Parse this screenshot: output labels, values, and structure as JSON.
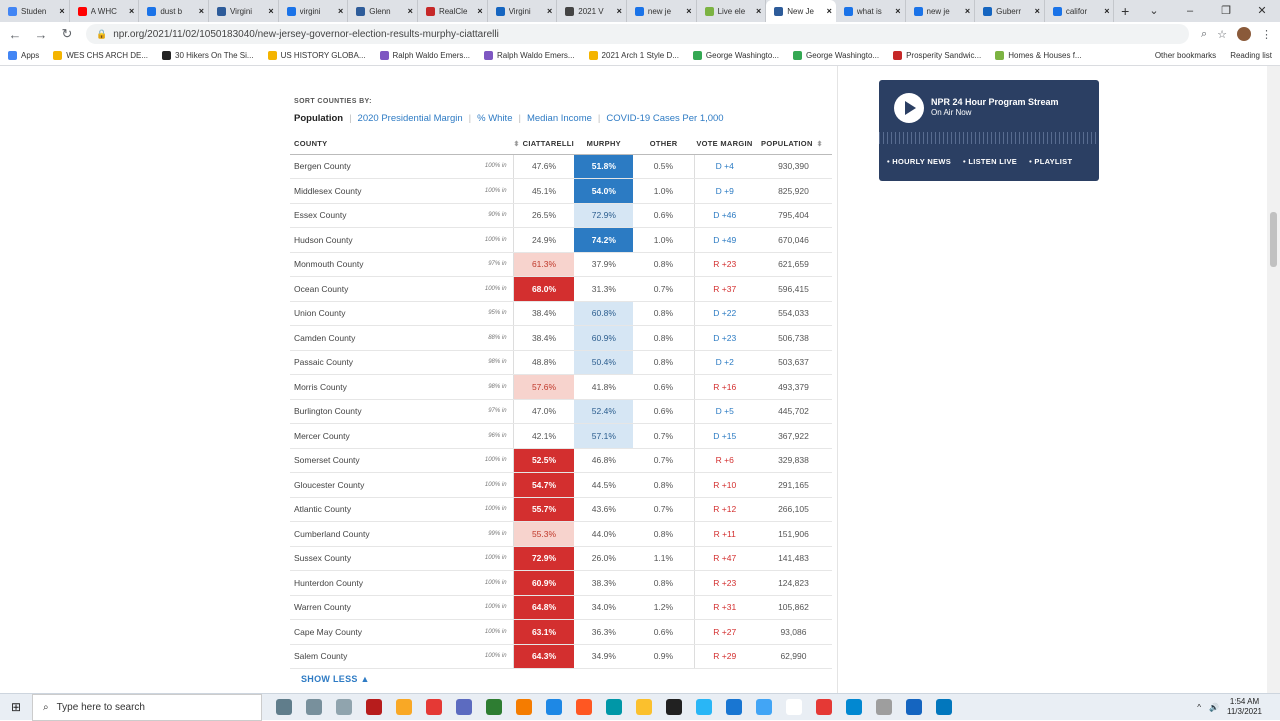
{
  "browser": {
    "tabs": [
      {
        "label": "Studen",
        "color": "#4285f4"
      },
      {
        "label": "A WHC",
        "color": "#ff0000"
      },
      {
        "label": "dust b",
        "color": "#1a73e8"
      },
      {
        "label": "Virgini",
        "color": "#2e5c9a"
      },
      {
        "label": "virgini",
        "color": "#1a73e8"
      },
      {
        "label": "Glenn",
        "color": "#2e5c9a"
      },
      {
        "label": "RealCle",
        "color": "#c62828"
      },
      {
        "label": "Virgini",
        "color": "#1565c0"
      },
      {
        "label": "2021 V",
        "color": "#444444"
      },
      {
        "label": "new je",
        "color": "#1a73e8"
      },
      {
        "label": "Live ele",
        "color": "#7cb342"
      },
      {
        "label": "New Je",
        "color": "#2e5c9a",
        "active": true
      },
      {
        "label": "what is",
        "color": "#1a73e8"
      },
      {
        "label": "new je",
        "color": "#1a73e8"
      },
      {
        "label": "Guberr",
        "color": "#1565c0"
      },
      {
        "label": "califor",
        "color": "#1a73e8"
      }
    ],
    "url": "npr.org/2021/11/02/1050183040/new-jersey-governor-election-results-murphy-ciattarelli",
    "bookmarks": [
      {
        "label": "Apps",
        "color": "#4285f4"
      },
      {
        "label": "WES CHS ARCH DE...",
        "color": "#f4b400"
      },
      {
        "label": "30 Hikers On The Si...",
        "color": "#222222"
      },
      {
        "label": "US HISTORY GLOBA...",
        "color": "#f4b400"
      },
      {
        "label": "Ralph Waldo Emers...",
        "color": "#7e57c2"
      },
      {
        "label": "Ralph Waldo Emers...",
        "color": "#7e57c2"
      },
      {
        "label": "2021 Arch 1 Style D...",
        "color": "#f4b400"
      },
      {
        "label": "George Washingto...",
        "color": "#34a853"
      },
      {
        "label": "George Washingto...",
        "color": "#34a853"
      },
      {
        "label": "Prosperity Sandwic...",
        "color": "#c62828"
      },
      {
        "label": "Homes & Houses f...",
        "color": "#7cb342"
      }
    ],
    "bookmarks_right": [
      "Other bookmarks",
      "Reading list"
    ]
  },
  "sort": {
    "label": "SORT COUNTIES BY:",
    "options": [
      "Population",
      "2020 Presidential Margin",
      "% White",
      "Median Income",
      "COVID-19 Cases Per 1,000"
    ]
  },
  "table": {
    "headers": [
      "COUNTY",
      "CIATTARELLI",
      "MURPHY",
      "OTHER",
      "VOTE MARGIN",
      "POPULATION"
    ],
    "rows": [
      {
        "county": "Bergen County",
        "pct_in": "100% in",
        "ciattarelli": "47.6%",
        "murphy": "51.8%",
        "other": "0.5%",
        "margin": "D +4",
        "population": "930,390",
        "shade": "d2"
      },
      {
        "county": "Middlesex County",
        "pct_in": "100% in",
        "ciattarelli": "45.1%",
        "murphy": "54.0%",
        "other": "1.0%",
        "margin": "D +9",
        "population": "825,920",
        "shade": "d2"
      },
      {
        "county": "Essex County",
        "pct_in": "90% in",
        "ciattarelli": "26.5%",
        "murphy": "72.9%",
        "other": "0.6%",
        "margin": "D +46",
        "population": "795,404",
        "shade": "d1"
      },
      {
        "county": "Hudson County",
        "pct_in": "100% in",
        "ciattarelli": "24.9%",
        "murphy": "74.2%",
        "other": "1.0%",
        "margin": "D +49",
        "population": "670,046",
        "shade": "d2"
      },
      {
        "county": "Monmouth County",
        "pct_in": "97% in",
        "ciattarelli": "61.3%",
        "murphy": "37.9%",
        "other": "0.8%",
        "margin": "R +23",
        "population": "621,659",
        "shade": "r1"
      },
      {
        "county": "Ocean County",
        "pct_in": "100% in",
        "ciattarelli": "68.0%",
        "murphy": "31.3%",
        "other": "0.7%",
        "margin": "R +37",
        "population": "596,415",
        "shade": "r2"
      },
      {
        "county": "Union County",
        "pct_in": "95% in",
        "ciattarelli": "38.4%",
        "murphy": "60.8%",
        "other": "0.8%",
        "margin": "D +22",
        "population": "554,033",
        "shade": "d1"
      },
      {
        "county": "Camden County",
        "pct_in": "88% in",
        "ciattarelli": "38.4%",
        "murphy": "60.9%",
        "other": "0.8%",
        "margin": "D +23",
        "population": "506,738",
        "shade": "d1"
      },
      {
        "county": "Passaic County",
        "pct_in": "98% in",
        "ciattarelli": "48.8%",
        "murphy": "50.4%",
        "other": "0.8%",
        "margin": "D +2",
        "population": "503,637",
        "shade": "d1"
      },
      {
        "county": "Morris County",
        "pct_in": "98% in",
        "ciattarelli": "57.6%",
        "murphy": "41.8%",
        "other": "0.6%",
        "margin": "R +16",
        "population": "493,379",
        "shade": "r1"
      },
      {
        "county": "Burlington County",
        "pct_in": "97% in",
        "ciattarelli": "47.0%",
        "murphy": "52.4%",
        "other": "0.6%",
        "margin": "D +5",
        "population": "445,702",
        "shade": "d1"
      },
      {
        "county": "Mercer County",
        "pct_in": "96% in",
        "ciattarelli": "42.1%",
        "murphy": "57.1%",
        "other": "0.7%",
        "margin": "D +15",
        "population": "367,922",
        "shade": "d1"
      },
      {
        "county": "Somerset County",
        "pct_in": "100% in",
        "ciattarelli": "52.5%",
        "murphy": "46.8%",
        "other": "0.7%",
        "margin": "R +6",
        "population": "329,838",
        "shade": "r2"
      },
      {
        "county": "Gloucester County",
        "pct_in": "100% in",
        "ciattarelli": "54.7%",
        "murphy": "44.5%",
        "other": "0.8%",
        "margin": "R +10",
        "population": "291,165",
        "shade": "r2"
      },
      {
        "county": "Atlantic County",
        "pct_in": "100% in",
        "ciattarelli": "55.7%",
        "murphy": "43.6%",
        "other": "0.7%",
        "margin": "R +12",
        "population": "266,105",
        "shade": "r2"
      },
      {
        "county": "Cumberland County",
        "pct_in": "99% in",
        "ciattarelli": "55.3%",
        "murphy": "44.0%",
        "other": "0.8%",
        "margin": "R +11",
        "population": "151,906",
        "shade": "r1"
      },
      {
        "county": "Sussex County",
        "pct_in": "100% in",
        "ciattarelli": "72.9%",
        "murphy": "26.0%",
        "other": "1.1%",
        "margin": "R +47",
        "population": "141,483",
        "shade": "r2"
      },
      {
        "county": "Hunterdon County",
        "pct_in": "100% in",
        "ciattarelli": "60.9%",
        "murphy": "38.3%",
        "other": "0.8%",
        "margin": "R +23",
        "population": "124,823",
        "shade": "r2"
      },
      {
        "county": "Warren County",
        "pct_in": "100% in",
        "ciattarelli": "64.8%",
        "murphy": "34.0%",
        "other": "1.2%",
        "margin": "R +31",
        "population": "105,862",
        "shade": "r2"
      },
      {
        "county": "Cape May County",
        "pct_in": "100% in",
        "ciattarelli": "63.1%",
        "murphy": "36.3%",
        "other": "0.6%",
        "margin": "R +27",
        "population": "93,086",
        "shade": "r2"
      },
      {
        "county": "Salem County",
        "pct_in": "100% in",
        "ciattarelli": "64.3%",
        "murphy": "34.9%",
        "other": "0.9%",
        "margin": "R +29",
        "population": "62,990",
        "shade": "r2"
      }
    ],
    "show_less": "SHOW LESS ▲"
  },
  "player": {
    "title": "NPR 24 Hour Program Stream",
    "subtitle": "On Air Now",
    "links": [
      "• HOURLY NEWS",
      "• LISTEN LIVE",
      "• PLAYLIST"
    ]
  },
  "taskbar": {
    "search_placeholder": "Type here to search",
    "time": "1:54 AM",
    "date": "11/3/2021",
    "app_colors": [
      "#607d8b",
      "#78909c",
      "#90a4ae",
      "#b71c1c",
      "#f9a825",
      "#e53935",
      "#5c6bc0",
      "#2e7d32",
      "#f57c00",
      "#1e88e5",
      "#ff5722",
      "#0097a7",
      "#fbc02d",
      "#212121",
      "#29b6f6",
      "#1976d2",
      "#42a5f5",
      "#ffffff",
      "#e53935",
      "#0288d1",
      "#9e9e9e",
      "#1565c0",
      "#0277bd"
    ]
  }
}
